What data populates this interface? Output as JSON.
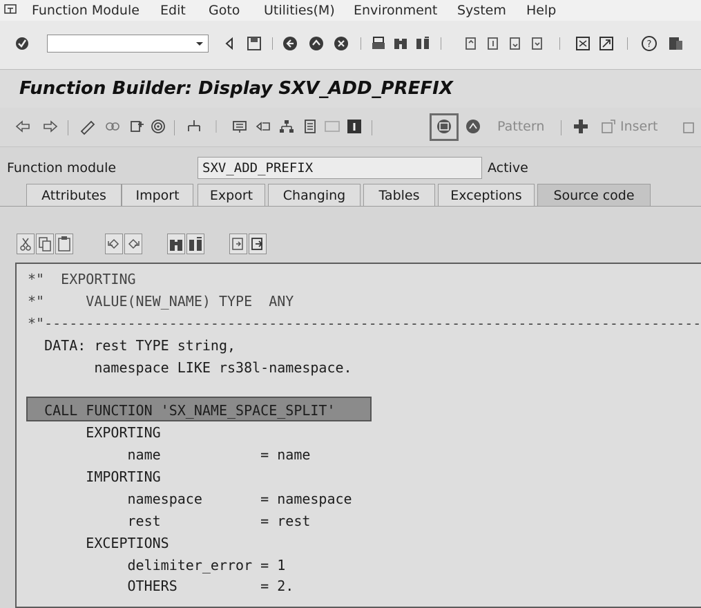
{
  "menu": [
    "Function Module",
    "Edit",
    "Goto",
    "Utilities(M)",
    "Environment",
    "System",
    "Help"
  ],
  "command_field": {
    "value": ""
  },
  "title": "Function Builder: Display SXV_ADD_PREFIX",
  "app_toolbar": {
    "pattern_label": "Pattern",
    "insert_label": "Insert"
  },
  "function_module": {
    "label": "Function module",
    "value": "SXV_ADD_PREFIX",
    "status": "Active"
  },
  "tabs": [
    "Attributes",
    "Import",
    "Export",
    "Changing",
    "Tables",
    "Exceptions",
    "Source code"
  ],
  "active_tab": "Source code",
  "code_lines": [
    "*\"  EXPORTING",
    "*\"     VALUE(NEW_NAME) TYPE  ANY",
    "*\"--------------------------------------------------------------------------------",
    "  DATA: rest TYPE string,",
    "        namespace LIKE rs38l-namespace.",
    "",
    "  CALL FUNCTION 'SX_NAME_SPACE_SPLIT'",
    "       EXPORTING",
    "            name            = name",
    "       IMPORTING",
    "            namespace       = namespace",
    "            rest            = rest",
    "       EXCEPTIONS",
    "            delimiter_error = 1",
    "            OTHERS          = 2."
  ]
}
